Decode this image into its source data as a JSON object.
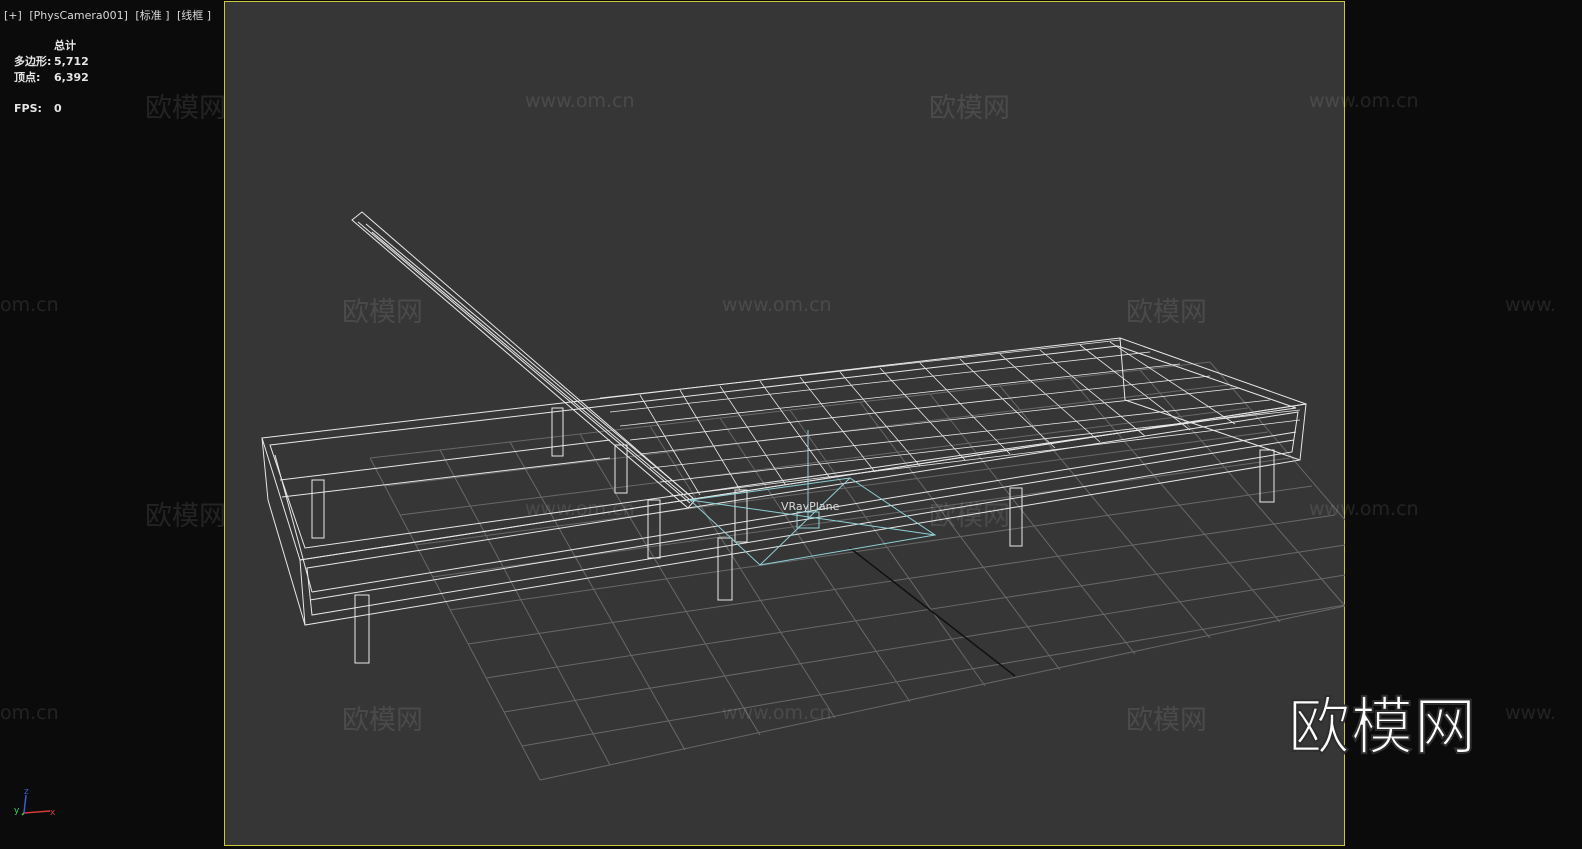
{
  "viewport": {
    "labels": [
      "[+]",
      "[PhysCamera001]",
      "[标准 ]",
      "[线框 ]"
    ]
  },
  "stats": {
    "header": "总计",
    "polygons_label": "多边形:",
    "polygons_value": "5,712",
    "vertices_label": "顶点:",
    "vertices_value": "6,392",
    "fps_label": "FPS:",
    "fps_value": "0"
  },
  "scene": {
    "object_label": "VRayPlane"
  },
  "watermarks": {
    "brand": "欧模网",
    "url": "www.om.cn",
    "url_partial": "om.cn",
    "url_partial_right": "www.",
    "big_logo": "欧模网"
  },
  "gizmo": {
    "x": "x",
    "y": "y",
    "z": "z"
  },
  "colors": {
    "viewport_bg": "#363636",
    "outer_bg": "#0b0b0b",
    "safe_frame_border": "#c9c93a",
    "wireframe": "#e8e8e8",
    "grid": "#6a6a6a",
    "vray_plane": "#8fd0d6"
  }
}
